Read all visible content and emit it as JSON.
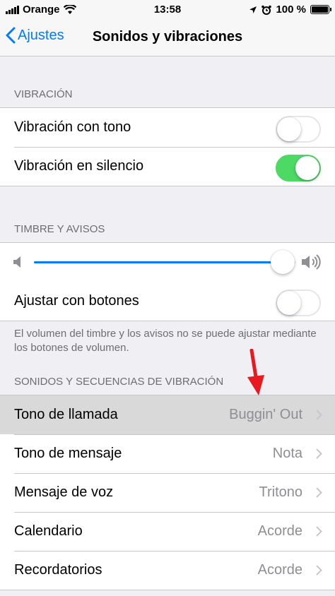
{
  "status_bar": {
    "carrier": "Orange",
    "time": "13:58",
    "battery": "100 %"
  },
  "nav": {
    "back_label": "Ajustes",
    "title": "Sonidos y vibraciones"
  },
  "vibration": {
    "header": "VIBRACIÓN",
    "items": [
      {
        "label": "Vibración con tono",
        "on": false
      },
      {
        "label": "Vibración en silencio",
        "on": true
      }
    ]
  },
  "ringer": {
    "header": "TIMBRE Y AVISOS",
    "volume_level": 0.95,
    "adjust_label": "Ajustar con botones",
    "adjust_on": false,
    "footnote": "El volumen del timbre y los avisos no se puede ajustar mediante los botones de volumen."
  },
  "sounds": {
    "header": "SONIDOS Y SECUENCIAS DE VIBRACIÓN",
    "items": [
      {
        "label": "Tono de llamada",
        "value": "Buggin' Out"
      },
      {
        "label": "Tono de mensaje",
        "value": "Nota"
      },
      {
        "label": "Mensaje de voz",
        "value": "Tritono"
      },
      {
        "label": "Calendario",
        "value": "Acorde"
      },
      {
        "label": "Recordatorios",
        "value": "Acorde"
      }
    ]
  },
  "colors": {
    "accent": "#007aff",
    "toggle_on": "#4cd964",
    "annotation_arrow": "#e8191f"
  }
}
